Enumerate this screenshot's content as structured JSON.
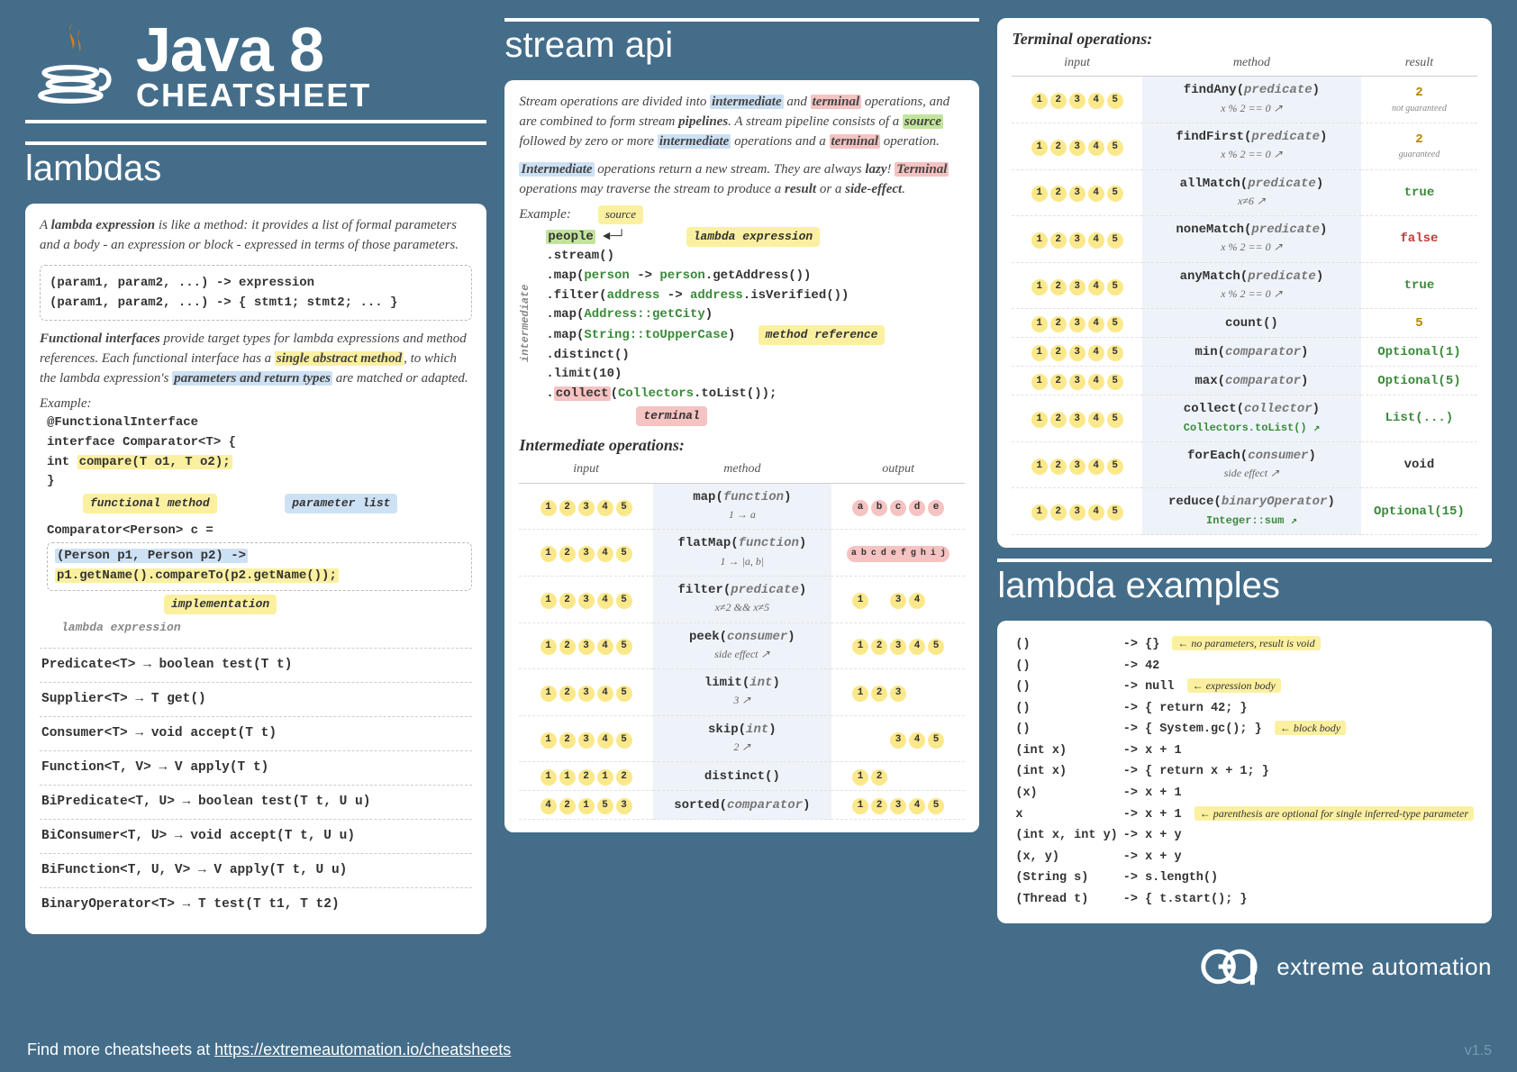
{
  "header": {
    "title_line1": "Java 8",
    "title_line2": "CHEATSHEET"
  },
  "sections": {
    "lambdas_title": "lambdas",
    "stream_title": "stream api",
    "lambda_examples_title": "lambda examples"
  },
  "lambdas": {
    "intro": "A lambda expression is like a method: it provides a list of formal parameters and a body - an expression or block - expressed in terms of those parameters.",
    "syntax1": "(param1, param2, ...) -> expression",
    "syntax2": "(param1, param2, ...) -> { stmt1; stmt2; ... }",
    "fi_intro_1": "Functional interfaces",
    "fi_intro_2": " provide target types for lambda expressions and method references. Each functional interface has a ",
    "fi_intro_3": "single abstract method",
    "fi_intro_4": ", to which the lambda expression's ",
    "fi_intro_5": "parameters and return types",
    "fi_intro_6": " are matched or adapted.",
    "example_label": "Example:",
    "fi_example": {
      "l1": "@FunctionalInterface",
      "l2": "interface Comparator<T> {",
      "l3_pre": "  int ",
      "l3_hl": "compare(T o1, T o2);",
      "l4": "}",
      "tag_fm": "functional method",
      "tag_pl": "parameter list",
      "l5": "Comparator<Person> c =",
      "l6": "  (Person p1, Person p2) ->",
      "l7": "    p1.getName().compareTo(p2.getName());",
      "tag_le": "lambda expression",
      "tag_impl": "implementation"
    },
    "fi_list": [
      "Predicate<T> → boolean test(T t)",
      "Supplier<T> → T get()",
      "Consumer<T> → void accept(T t)",
      "Function<T, V> → V apply(T t)",
      "BiPredicate<T, U> → boolean test(T t, U u)",
      "BiConsumer<T, U> → void accept(T t, U u)",
      "BiFunction<T, U, V> → V apply(T t, U u)",
      "BinaryOperator<T> → T test(T t1, T t2)"
    ]
  },
  "stream": {
    "intro_parts": {
      "p1": "Stream operations are divided into ",
      "intermediate": "intermediate",
      "p2": " and ",
      "terminal": "terminal",
      "p3": " operations, and are combined to form stream ",
      "pipelines": "pipelines",
      "p4": ". A stream pipeline consists of a ",
      "source": "source",
      "p5": " followed by zero or more ",
      "p6": " operations and a ",
      "p7": " operation."
    },
    "intro2_parts": {
      "p1": "Intermediate",
      "p2": " operations return a new stream. They are always ",
      "lazy": "lazy",
      "p3": "! ",
      "p4": "Terminal",
      "p5": " operations may traverse the stream to produce a ",
      "result": "result",
      "p6": " or a ",
      "side_effect": "side-effect",
      "p7": "."
    },
    "example_label": "Example:",
    "tags": {
      "source": "source",
      "lambda_expression": "lambda expression",
      "method_reference": "method reference",
      "terminal": "terminal",
      "intermediate": "intermediate"
    },
    "code": {
      "l1": "people",
      "l2": "  .stream()",
      "l3a": "  .map(",
      "l3b": "person",
      "l3c": " -> ",
      "l3d": "person",
      "l3e": ".getAddress())",
      "l4a": "  .filter(",
      "l4b": "address",
      "l4c": " -> ",
      "l4d": "address",
      "l4e": ".isVerified())",
      "l5a": "  .map(",
      "l5b": "Address::getCity",
      "l5c": ")",
      "l6a": "  .map(",
      "l6b": "String::toUpperCase",
      "l6c": ")",
      "l7": "  .distinct()",
      "l8": "  .limit(10)",
      "l9a": "  .",
      "l9b": "collect",
      "l9c": "(",
      "l9d": "Collectors",
      "l9e": ".toList());"
    },
    "intermediate_title": "Intermediate operations:",
    "terminal_title": "Terminal operations:",
    "headers": {
      "input": "input",
      "method": "method",
      "output": "output",
      "result": "result"
    },
    "intermediate_ops": [
      {
        "input": [
          "1",
          "2",
          "3",
          "4",
          "5"
        ],
        "method": "map",
        "arg": "function",
        "sub": "1 → a",
        "output_type": "letters",
        "output": [
          "a",
          "b",
          "c",
          "d",
          "e"
        ]
      },
      {
        "input": [
          "1",
          "2",
          "3",
          "4",
          "5"
        ],
        "method": "flatMap",
        "arg": "function",
        "sub": "1 → |a, b|",
        "output_type": "long",
        "output": [
          "a b c d e f g h i j"
        ]
      },
      {
        "input": [
          "1",
          "2",
          "3",
          "4",
          "5"
        ],
        "method": "filter",
        "arg": "predicate",
        "sub": "x≠2 && x≠5",
        "output_type": "sparse",
        "output": [
          "1",
          "",
          "3",
          "4",
          ""
        ]
      },
      {
        "input": [
          "1",
          "2",
          "3",
          "4",
          "5"
        ],
        "method": "peek",
        "arg": "consumer",
        "sub": "side effect ↗",
        "output_type": "nums",
        "output": [
          "1",
          "2",
          "3",
          "4",
          "5"
        ]
      },
      {
        "input": [
          "1",
          "2",
          "3",
          "4",
          "5"
        ],
        "method": "limit",
        "arg": "int",
        "sub": "3 ↗",
        "output_type": "sparse",
        "output": [
          "1",
          "2",
          "3",
          "",
          ""
        ]
      },
      {
        "input": [
          "1",
          "2",
          "3",
          "4",
          "5"
        ],
        "method": "skip",
        "arg": "int",
        "sub": "2 ↗",
        "output_type": "sparse",
        "output": [
          "",
          "",
          "3",
          "4",
          "5"
        ]
      },
      {
        "input": [
          "1",
          "1",
          "2",
          "1",
          "2"
        ],
        "method": "distinct",
        "arg": "",
        "sub": "",
        "output_type": "sparse",
        "output": [
          "1",
          "2",
          "",
          "",
          ""
        ]
      },
      {
        "input": [
          "4",
          "2",
          "1",
          "5",
          "3"
        ],
        "method": "sorted",
        "arg": "comparator",
        "sub": "",
        "output_type": "nums",
        "output": [
          "1",
          "2",
          "3",
          "4",
          "5"
        ]
      }
    ],
    "terminal_ops": [
      {
        "input": [
          "1",
          "2",
          "3",
          "4",
          "5"
        ],
        "method": "findAny",
        "arg": "predicate",
        "sub": "x % 2 == 0 ↗",
        "result": "2",
        "note": "not guaranteed",
        "rc": "gold"
      },
      {
        "input": [
          "1",
          "2",
          "3",
          "4",
          "5"
        ],
        "method": "findFirst",
        "arg": "predicate",
        "sub": "x % 2 == 0 ↗",
        "result": "2",
        "note": "guaranteed",
        "rc": "gold"
      },
      {
        "input": [
          "1",
          "2",
          "3",
          "4",
          "5"
        ],
        "method": "allMatch",
        "arg": "predicate",
        "sub": "x≠6 ↗",
        "result": "true",
        "rc": "green"
      },
      {
        "input": [
          "1",
          "2",
          "3",
          "4",
          "5"
        ],
        "method": "noneMatch",
        "arg": "predicate",
        "sub": "x % 2 == 0 ↗",
        "result": "false",
        "rc": "red"
      },
      {
        "input": [
          "1",
          "2",
          "3",
          "4",
          "5"
        ],
        "method": "anyMatch",
        "arg": "predicate",
        "sub": "x % 2 == 0 ↗",
        "result": "true",
        "rc": "green"
      },
      {
        "input": [
          "1",
          "2",
          "3",
          "4",
          "5"
        ],
        "method": "count",
        "arg": "",
        "sub": "",
        "result": "5",
        "rc": "gold"
      },
      {
        "input": [
          "1",
          "2",
          "3",
          "4",
          "5"
        ],
        "method": "min",
        "arg": "comparator",
        "sub": "",
        "result": "Optional(1)",
        "rc": "green"
      },
      {
        "input": [
          "1",
          "2",
          "3",
          "4",
          "5"
        ],
        "method": "max",
        "arg": "comparator",
        "sub": "",
        "result": "Optional(5)",
        "rc": "green"
      },
      {
        "input": [
          "1",
          "2",
          "3",
          "4",
          "5"
        ],
        "method": "collect",
        "arg": "collector",
        "sub": "Collectors.toList() ↗",
        "sub_mono": true,
        "result": "List(...)",
        "rc": "green"
      },
      {
        "input": [
          "1",
          "2",
          "3",
          "4",
          "5"
        ],
        "method": "forEach",
        "arg": "consumer",
        "sub": "side effect ↗",
        "result": "void",
        "rc": ""
      },
      {
        "input": [
          "1",
          "2",
          "3",
          "4",
          "5"
        ],
        "method": "reduce",
        "arg": "binaryOperator",
        "sub": "Integer::sum ↗",
        "sub_mono": true,
        "result": "Optional(15)",
        "rc": "green"
      }
    ]
  },
  "lambda_examples": [
    {
      "p": "()",
      "b": "-> {}",
      "note": "no parameters, result is void"
    },
    {
      "p": "()",
      "b": "-> 42",
      "note": ""
    },
    {
      "p": "()",
      "b": "-> null",
      "note": "expression body"
    },
    {
      "p": "()",
      "b": "-> { return 42; }",
      "note": ""
    },
    {
      "p": "()",
      "b": "-> { System.gc(); }",
      "note": "block body"
    },
    {
      "p": "(int x)",
      "b": "-> x + 1",
      "note": ""
    },
    {
      "p": "(int x)",
      "b": "-> { return x + 1; }",
      "note": ""
    },
    {
      "p": "(x)",
      "b": "-> x + 1",
      "note": ""
    },
    {
      "p": "x",
      "b": "-> x + 1",
      "note": "parenthesis are optional for single inferred-type parameter"
    },
    {
      "p": "(int x, int y)",
      "b": "-> x + y",
      "note": ""
    },
    {
      "p": "(x, y)",
      "b": "-> x + y",
      "note": ""
    },
    {
      "p": "(String s)",
      "b": "-> s.length()",
      "note": ""
    },
    {
      "p": "(Thread t)",
      "b": "-> { t.start(); }",
      "note": ""
    }
  ],
  "footer": {
    "text": "Find more cheatsheets at ",
    "link": "https://extremeautomation.io/cheatsheets",
    "brand": "extreme automation",
    "version": "v1.5"
  }
}
